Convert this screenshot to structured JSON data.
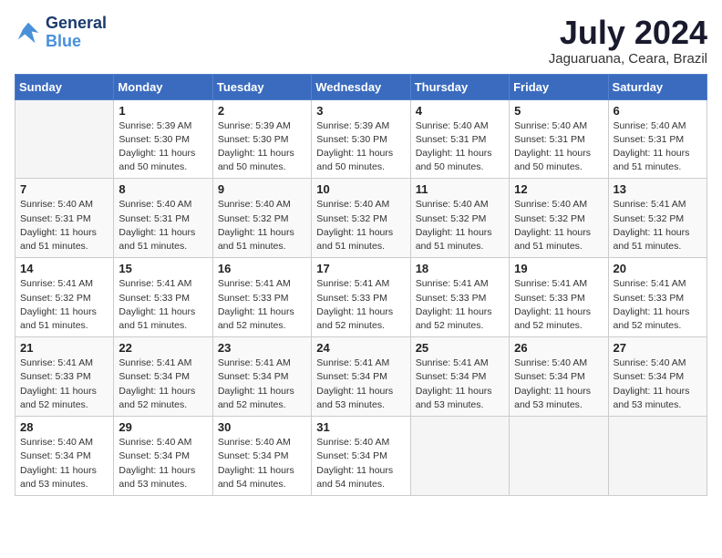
{
  "header": {
    "logo_line1": "General",
    "logo_line2": "Blue",
    "month_title": "July 2024",
    "location": "Jaguaruana, Ceara, Brazil"
  },
  "weekdays": [
    "Sunday",
    "Monday",
    "Tuesday",
    "Wednesday",
    "Thursday",
    "Friday",
    "Saturday"
  ],
  "weeks": [
    [
      {
        "day": "",
        "info": ""
      },
      {
        "day": "1",
        "info": "Sunrise: 5:39 AM\nSunset: 5:30 PM\nDaylight: 11 hours\nand 50 minutes."
      },
      {
        "day": "2",
        "info": "Sunrise: 5:39 AM\nSunset: 5:30 PM\nDaylight: 11 hours\nand 50 minutes."
      },
      {
        "day": "3",
        "info": "Sunrise: 5:39 AM\nSunset: 5:30 PM\nDaylight: 11 hours\nand 50 minutes."
      },
      {
        "day": "4",
        "info": "Sunrise: 5:40 AM\nSunset: 5:31 PM\nDaylight: 11 hours\nand 50 minutes."
      },
      {
        "day": "5",
        "info": "Sunrise: 5:40 AM\nSunset: 5:31 PM\nDaylight: 11 hours\nand 50 minutes."
      },
      {
        "day": "6",
        "info": "Sunrise: 5:40 AM\nSunset: 5:31 PM\nDaylight: 11 hours\nand 51 minutes."
      }
    ],
    [
      {
        "day": "7",
        "info": "Sunrise: 5:40 AM\nSunset: 5:31 PM\nDaylight: 11 hours\nand 51 minutes."
      },
      {
        "day": "8",
        "info": "Sunrise: 5:40 AM\nSunset: 5:31 PM\nDaylight: 11 hours\nand 51 minutes."
      },
      {
        "day": "9",
        "info": "Sunrise: 5:40 AM\nSunset: 5:32 PM\nDaylight: 11 hours\nand 51 minutes."
      },
      {
        "day": "10",
        "info": "Sunrise: 5:40 AM\nSunset: 5:32 PM\nDaylight: 11 hours\nand 51 minutes."
      },
      {
        "day": "11",
        "info": "Sunrise: 5:40 AM\nSunset: 5:32 PM\nDaylight: 11 hours\nand 51 minutes."
      },
      {
        "day": "12",
        "info": "Sunrise: 5:40 AM\nSunset: 5:32 PM\nDaylight: 11 hours\nand 51 minutes."
      },
      {
        "day": "13",
        "info": "Sunrise: 5:41 AM\nSunset: 5:32 PM\nDaylight: 11 hours\nand 51 minutes."
      }
    ],
    [
      {
        "day": "14",
        "info": "Sunrise: 5:41 AM\nSunset: 5:32 PM\nDaylight: 11 hours\nand 51 minutes."
      },
      {
        "day": "15",
        "info": "Sunrise: 5:41 AM\nSunset: 5:33 PM\nDaylight: 11 hours\nand 51 minutes."
      },
      {
        "day": "16",
        "info": "Sunrise: 5:41 AM\nSunset: 5:33 PM\nDaylight: 11 hours\nand 52 minutes."
      },
      {
        "day": "17",
        "info": "Sunrise: 5:41 AM\nSunset: 5:33 PM\nDaylight: 11 hours\nand 52 minutes."
      },
      {
        "day": "18",
        "info": "Sunrise: 5:41 AM\nSunset: 5:33 PM\nDaylight: 11 hours\nand 52 minutes."
      },
      {
        "day": "19",
        "info": "Sunrise: 5:41 AM\nSunset: 5:33 PM\nDaylight: 11 hours\nand 52 minutes."
      },
      {
        "day": "20",
        "info": "Sunrise: 5:41 AM\nSunset: 5:33 PM\nDaylight: 11 hours\nand 52 minutes."
      }
    ],
    [
      {
        "day": "21",
        "info": "Sunrise: 5:41 AM\nSunset: 5:33 PM\nDaylight: 11 hours\nand 52 minutes."
      },
      {
        "day": "22",
        "info": "Sunrise: 5:41 AM\nSunset: 5:34 PM\nDaylight: 11 hours\nand 52 minutes."
      },
      {
        "day": "23",
        "info": "Sunrise: 5:41 AM\nSunset: 5:34 PM\nDaylight: 11 hours\nand 52 minutes."
      },
      {
        "day": "24",
        "info": "Sunrise: 5:41 AM\nSunset: 5:34 PM\nDaylight: 11 hours\nand 53 minutes."
      },
      {
        "day": "25",
        "info": "Sunrise: 5:41 AM\nSunset: 5:34 PM\nDaylight: 11 hours\nand 53 minutes."
      },
      {
        "day": "26",
        "info": "Sunrise: 5:40 AM\nSunset: 5:34 PM\nDaylight: 11 hours\nand 53 minutes."
      },
      {
        "day": "27",
        "info": "Sunrise: 5:40 AM\nSunset: 5:34 PM\nDaylight: 11 hours\nand 53 minutes."
      }
    ],
    [
      {
        "day": "28",
        "info": "Sunrise: 5:40 AM\nSunset: 5:34 PM\nDaylight: 11 hours\nand 53 minutes."
      },
      {
        "day": "29",
        "info": "Sunrise: 5:40 AM\nSunset: 5:34 PM\nDaylight: 11 hours\nand 53 minutes."
      },
      {
        "day": "30",
        "info": "Sunrise: 5:40 AM\nSunset: 5:34 PM\nDaylight: 11 hours\nand 54 minutes."
      },
      {
        "day": "31",
        "info": "Sunrise: 5:40 AM\nSunset: 5:34 PM\nDaylight: 11 hours\nand 54 minutes."
      },
      {
        "day": "",
        "info": ""
      },
      {
        "day": "",
        "info": ""
      },
      {
        "day": "",
        "info": ""
      }
    ]
  ]
}
